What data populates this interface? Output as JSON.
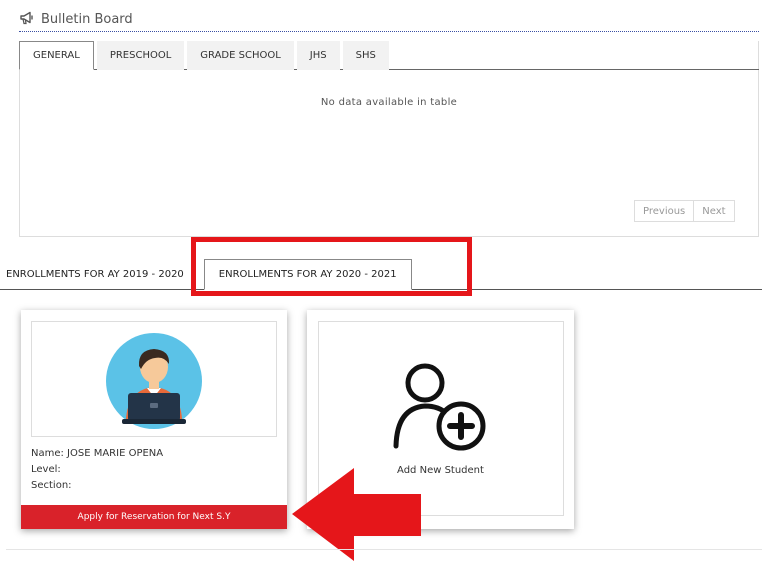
{
  "bulletin": {
    "icon": "megaphone-icon",
    "title": "Bulletin Board",
    "tabs": [
      {
        "label": "GENERAL",
        "active": true
      },
      {
        "label": "PRESCHOOL",
        "active": false
      },
      {
        "label": "GRADE SCHOOL",
        "active": false
      },
      {
        "label": "JHS",
        "active": false
      },
      {
        "label": "SHS",
        "active": false
      }
    ],
    "empty_message": "No data available in table",
    "pager": {
      "previous": "Previous",
      "next": "Next"
    }
  },
  "enrollments": {
    "tabs": [
      {
        "label": "ENROLLMENTS FOR AY 2019 - 2020",
        "active": false
      },
      {
        "label": "ENROLLMENTS FOR AY 2020 - 2021",
        "active": true
      }
    ],
    "highlight_color": "#e5161a"
  },
  "student_card": {
    "avatar_icon": "student-avatar-icon",
    "name_line": "Name: JOSE MARIE OPENA",
    "level_line": "Level:",
    "section_line": "Section:",
    "apply_button": "Apply for Reservation for Next S.Y",
    "button_color": "#d9222a"
  },
  "add_card": {
    "icon": "add-user-icon",
    "label": "Add New Student"
  },
  "annotation": {
    "icon": "red-arrow-icon",
    "color": "#e5161a"
  }
}
